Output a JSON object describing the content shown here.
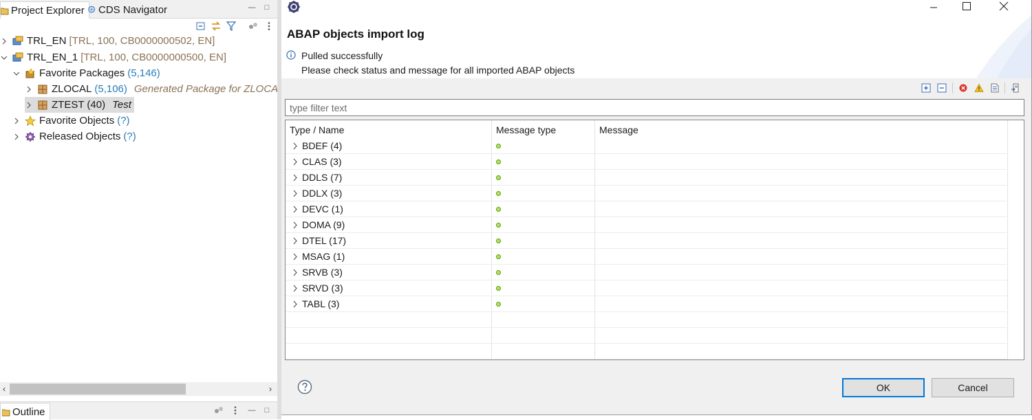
{
  "left_pane": {
    "tabs": [
      {
        "label": "Project Explorer"
      },
      {
        "label": "CDS Navigator"
      }
    ],
    "tree": [
      {
        "label": "TRL_EN",
        "meta": "[TRL, 100, CB0000000502, EN]"
      },
      {
        "label": "TRL_EN_1",
        "meta": "[TRL, 100, CB0000000500, EN]"
      },
      {
        "label": "Favorite Packages",
        "count": "(5,146)"
      },
      {
        "label": "ZLOCAL",
        "count": "(5,106)",
        "desc": "Generated Package for ZLOCAL"
      },
      {
        "label": "ZTEST (40)",
        "desc": "Test"
      },
      {
        "label": "Favorite Objects",
        "count": "(?)"
      },
      {
        "label": "Released Objects",
        "count": "(?)"
      }
    ],
    "outline_tab": {
      "label": "Outline"
    }
  },
  "dialog": {
    "title": "ABAP objects import log",
    "message_line1": "Pulled successfully",
    "message_line2": "Please check status and message for all imported ABAP objects",
    "filter_placeholder": "type filter text",
    "columns": [
      "Type / Name",
      "Message type",
      "Message"
    ],
    "rows": [
      {
        "name": "BDEF (4)",
        "status": "success"
      },
      {
        "name": "CLAS (3)",
        "status": "success"
      },
      {
        "name": "DDLS (7)",
        "status": "success"
      },
      {
        "name": "DDLX (3)",
        "status": "success"
      },
      {
        "name": "DEVC (1)",
        "status": "success"
      },
      {
        "name": "DOMA (9)",
        "status": "success"
      },
      {
        "name": "DTEL (17)",
        "status": "success"
      },
      {
        "name": "MSAG (1)",
        "status": "success"
      },
      {
        "name": "SRVB (3)",
        "status": "success"
      },
      {
        "name": "SRVD (3)",
        "status": "success"
      },
      {
        "name": "TABL (3)",
        "status": "success"
      }
    ],
    "ok_label": "OK",
    "cancel_label": "Cancel"
  },
  "colors": {
    "accent": "#0078d7",
    "success_dot": "#b5e06e",
    "meta_text": "#8b7355",
    "count_text": "#2a7db8"
  }
}
